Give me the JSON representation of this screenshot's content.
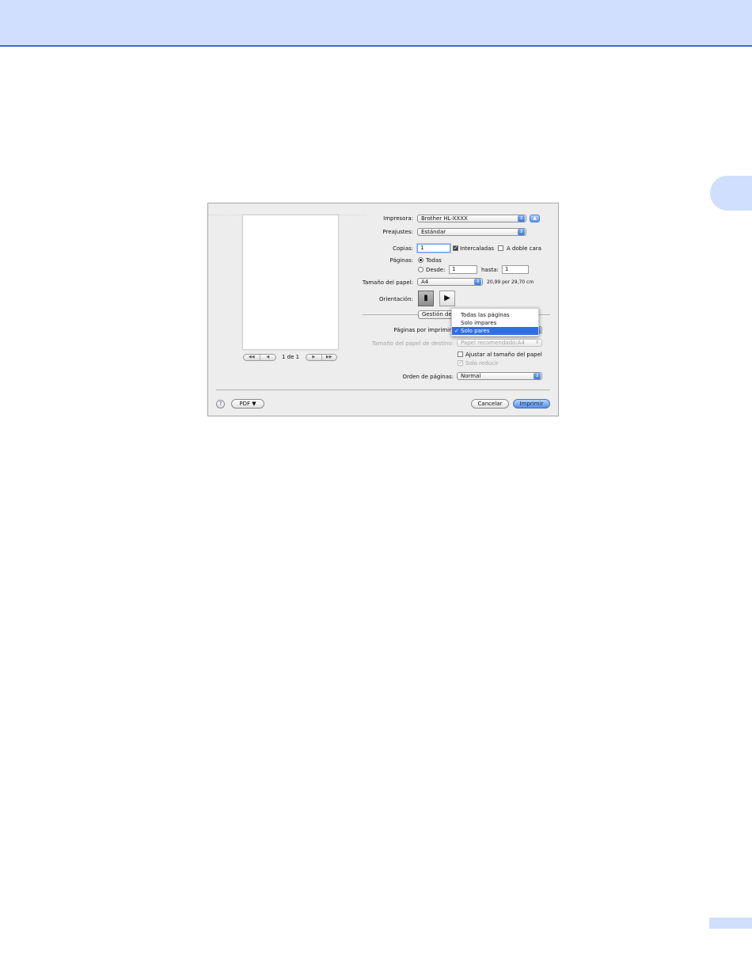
{
  "colors": {
    "banner": "#cfdffd",
    "banner_rule": "#3f6fbf",
    "highlight": "#2f6de6",
    "default_button": "#4e8fe8"
  },
  "dialog": {
    "preview_nav": {
      "first": "◀◀",
      "prev": "◀",
      "page_indicator": "1 de 1",
      "next": "▶",
      "last": "▶▶"
    },
    "printer": {
      "label": "Impresora:",
      "value": "Brother HL-XXXX",
      "collapse_icon": "disclosure-up-icon"
    },
    "presets": {
      "label": "Preajustes:",
      "value": "Estándar"
    },
    "copies": {
      "label": "Copias:",
      "value": "1",
      "collated_label": "Intercaladas",
      "collated_checked": true,
      "duplex_label": "A doble cara",
      "duplex_checked": false
    },
    "pages": {
      "label": "Páginas:",
      "all_label": "Todas",
      "all_selected": true,
      "from_label": "Desde:",
      "from_value": "1",
      "to_label": "hasta:",
      "to_value": "1"
    },
    "paper_size": {
      "label": "Tamaño del papel:",
      "value": "A4",
      "dimensions": "20,99 por 29,70 cm"
    },
    "orientation": {
      "label": "Orientación:",
      "portrait_icon": "portrait-orientation-icon",
      "landscape_icon": "landscape-orientation-icon",
      "selected": "portrait"
    },
    "section_popup": {
      "value": "Gestión de"
    },
    "pages_to_print": {
      "label": "Páginas por imprimir",
      "menu_items": [
        "Todas las páginas",
        "Solo impares",
        "Solo pares"
      ],
      "selected": "Solo pares",
      "check_mark": "✓"
    },
    "destination_paper": {
      "label": "Tamaño del papel de destino:",
      "value": "Papel recomendado:A4"
    },
    "scale_to_fit": {
      "label": "Ajustar al tamaño del papel",
      "checked": false
    },
    "scale_down_only": {
      "label": "Solo reducir",
      "checked": true
    },
    "page_order": {
      "label": "Orden de páginas:",
      "value": "Normal"
    },
    "footer": {
      "help": "?",
      "pdf": "PDF ▼",
      "cancel": "Cancelar",
      "print": "Imprimir"
    }
  }
}
